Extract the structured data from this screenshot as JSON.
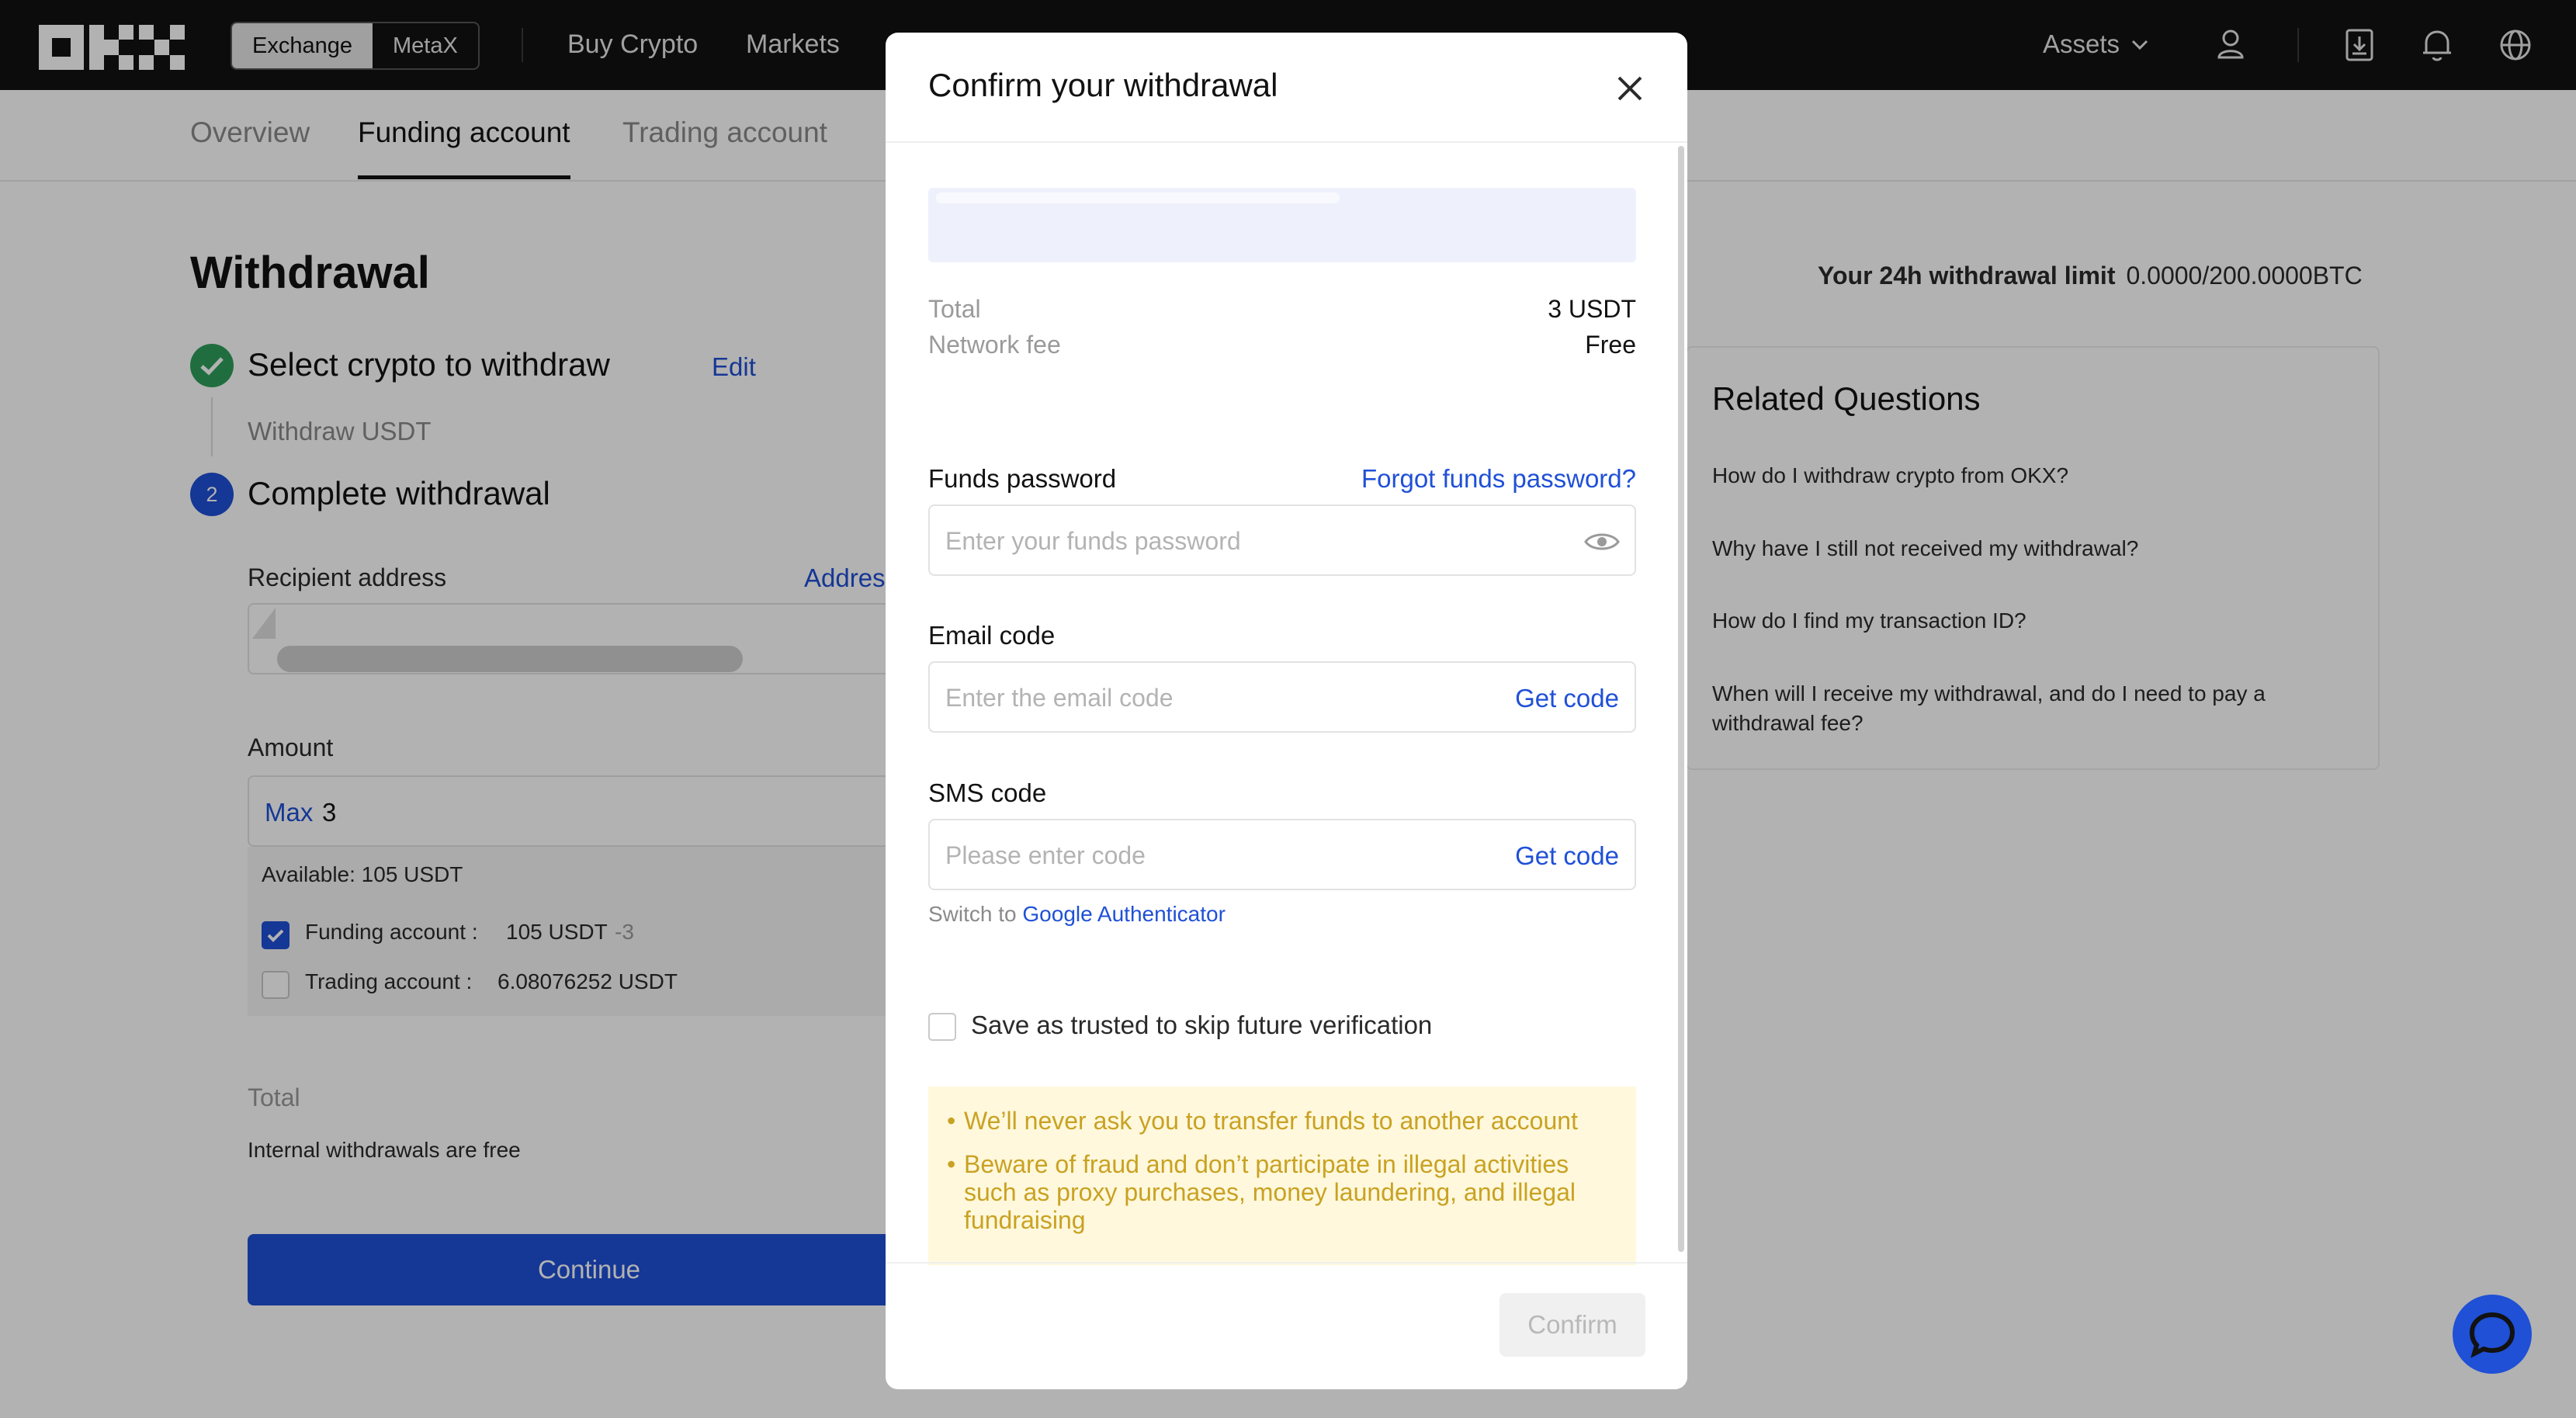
{
  "header": {
    "logo": "OKX",
    "segments": [
      "Exchange",
      "MetaX"
    ],
    "nav": [
      "Buy Crypto",
      "Markets"
    ],
    "assets_label": "Assets"
  },
  "subtabs": [
    "Overview",
    "Funding account",
    "Trading account"
  ],
  "page": {
    "title": "Withdrawal",
    "step1_title": "Select crypto to withdraw",
    "edit_label": "Edit",
    "step1_sub": "Withdraw USDT",
    "step2_number": "2",
    "step2_title": "Complete withdrawal",
    "recipient_label": "Recipient address",
    "address_link": "Addres",
    "amount_label": "Amount",
    "max_label": "Max",
    "amount_value": "3",
    "available": "Available:  105 USDT",
    "funding_label": "Funding account :",
    "funding_value": "105 USDT",
    "funding_delta": "-3",
    "trading_label": "Trading account :",
    "trading_value": "6.08076252 USDT",
    "total_label": "Total",
    "free_note": "Internal withdrawals are free",
    "continue_label": "Continue"
  },
  "right": {
    "limit_label": "Your 24h withdrawal limit",
    "limit_value": "0.0000/200.0000BTC",
    "rq_title": "Related Questions",
    "questions": [
      "How do I withdraw crypto from OKX?",
      "Why have I still not received my withdrawal?",
      "How do I find my transaction ID?",
      "When will I receive my withdrawal, and do I need to pay a withdrawal fee?"
    ]
  },
  "modal": {
    "title": "Confirm your withdrawal",
    "total_label": "Total",
    "total_value": "3 USDT",
    "fee_label": "Network fee",
    "fee_value": "Free",
    "funds_pw_label": "Funds password",
    "forgot_label": "Forgot funds password?",
    "funds_pw_placeholder": "Enter your funds password",
    "email_label": "Email code",
    "email_placeholder": "Enter the email code",
    "get_code": "Get code",
    "sms_label": "SMS code",
    "sms_placeholder": "Please enter code",
    "switch_prefix": "Switch to",
    "switch_link": "Google Authenticator",
    "trust_label": "Save as trusted to skip future verification",
    "warnings": [
      "We’ll never ask you to transfer funds to another account",
      "Beware of fraud and don’t participate in illegal activities such as proxy purchases, money laundering, and illegal fundraising"
    ],
    "confirm_label": "Confirm"
  },
  "colors": {
    "accent": "#1f50d6",
    "success": "#2e9e5b",
    "warning_text": "#c9a223",
    "warning_bg": "#fff8dc",
    "topbar": "#121212"
  },
  "icons": [
    "okx-logo",
    "chevron-down-icon",
    "user-icon",
    "download-icon",
    "bell-icon",
    "globe-icon",
    "check-icon",
    "close-icon",
    "eye-icon",
    "chat-icon"
  ]
}
